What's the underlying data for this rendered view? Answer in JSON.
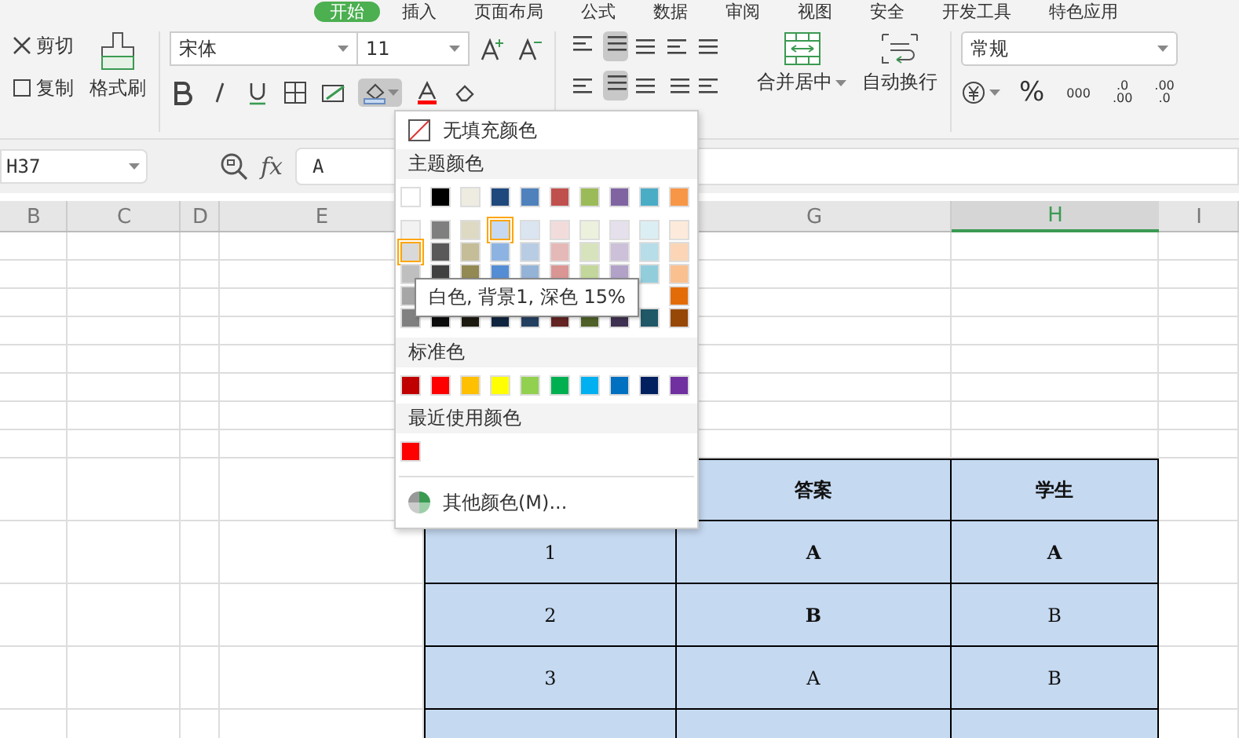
{
  "tabs": [
    {
      "label": "开始",
      "selected": true
    },
    {
      "label": "插入",
      "selected": false
    },
    {
      "label": "页面布局",
      "selected": false
    },
    {
      "label": "公式",
      "selected": false
    },
    {
      "label": "数据",
      "selected": false
    },
    {
      "label": "审阅",
      "selected": false
    },
    {
      "label": "视图",
      "selected": false
    },
    {
      "label": "安全",
      "selected": false
    },
    {
      "label": "开发工具",
      "selected": false
    },
    {
      "label": "特色应用",
      "selected": false
    }
  ],
  "clipboard": {
    "cut": "剪切",
    "copy": "复制",
    "format_painter": "格式刷"
  },
  "font": {
    "name": "宋体",
    "size": "11"
  },
  "alignment": {
    "merge": "合并居中",
    "wrap": "自动换行"
  },
  "number": {
    "format": "常规",
    "percent": "%",
    "thousands": "000",
    "decimals": [
      {
        "top": ".0",
        "bottom": ".00"
      },
      {
        "top": ".00",
        "bottom": ".0"
      }
    ]
  },
  "formula_bar": {
    "name_box": "H37",
    "function_label": "fx",
    "formula": "A"
  },
  "columns": [
    {
      "label": "B",
      "selected": false
    },
    {
      "label": "C",
      "selected": false
    },
    {
      "label": "D",
      "selected": false
    },
    {
      "label": "E",
      "selected": false
    },
    {
      "label": "G",
      "selected": false
    },
    {
      "label": "H",
      "selected": true
    },
    {
      "label": "I",
      "selected": false
    }
  ],
  "table": {
    "header": [
      "答案",
      "学生"
    ],
    "rows": [
      [
        {
          "text": "1",
          "bold": false
        },
        {
          "text": "A",
          "bold": true
        },
        {
          "text": "A",
          "bold": true
        }
      ],
      [
        {
          "text": "2",
          "bold": false
        },
        {
          "text": "B",
          "bold": true
        },
        {
          "text": "B",
          "bold": false
        }
      ],
      [
        {
          "text": "3",
          "bold": false
        },
        {
          "text": "A",
          "bold": false
        },
        {
          "text": "B",
          "bold": false
        }
      ]
    ]
  },
  "fill_menu": {
    "no_fill": "无填充颜色",
    "theme_title": "主题颜色",
    "standard_title": "标准色",
    "recent_title": "最近使用颜色",
    "more": "其他颜色(M)...",
    "tooltip": "白色, 背景1, 深色 15%",
    "theme_rows": [
      [
        {
          "color": "#ffffff",
          "selected": false
        },
        {
          "color": "#000000",
          "selected": false
        },
        {
          "color": "#eeece1",
          "selected": false
        },
        {
          "color": "#1f497d",
          "selected": false
        },
        {
          "color": "#4f81bd",
          "selected": false
        },
        {
          "color": "#c0504d",
          "selected": false
        },
        {
          "color": "#9bbb59",
          "selected": false
        },
        {
          "color": "#8064a2",
          "selected": false
        },
        {
          "color": "#4bacc6",
          "selected": false
        },
        {
          "color": "#f79646",
          "selected": false
        }
      ],
      [
        {
          "color": "#f2f2f2",
          "selected": false
        },
        {
          "color": "#7f7f7f",
          "selected": false
        },
        {
          "color": "#ddd9c3",
          "selected": false
        },
        {
          "color": "#c6d9f0",
          "selected": true
        },
        {
          "color": "#dbe5f1",
          "selected": false
        },
        {
          "color": "#f2dcdb",
          "selected": false
        },
        {
          "color": "#ebf1dd",
          "selected": false
        },
        {
          "color": "#e5e0ec",
          "selected": false
        },
        {
          "color": "#dbeef3",
          "selected": false
        },
        {
          "color": "#fdeada",
          "selected": false
        }
      ],
      [
        {
          "color": "#d9d9d9",
          "selected": true
        },
        {
          "color": "#595959",
          "selected": false
        },
        {
          "color": "#c4bd97",
          "selected": false
        },
        {
          "color": "#8db3e2",
          "selected": false
        },
        {
          "color": "#b8cce4",
          "selected": false
        },
        {
          "color": "#e5b9b7",
          "selected": false
        },
        {
          "color": "#d7e3bc",
          "selected": false
        },
        {
          "color": "#ccc1d9",
          "selected": false
        },
        {
          "color": "#b7dde8",
          "selected": false
        },
        {
          "color": "#fbd5b5",
          "selected": false
        }
      ],
      [
        {
          "color": "#bfbfbf",
          "selected": false
        },
        {
          "color": "#404040",
          "selected": false
        },
        {
          "color": "#938953",
          "selected": false
        },
        {
          "color": "#548dd4",
          "selected": false
        },
        {
          "color": "#95b3d7",
          "selected": false
        },
        {
          "color": "#d99694",
          "selected": false
        },
        {
          "color": "#c3d69b",
          "selected": false
        },
        {
          "color": "#b2a2c7",
          "selected": false
        },
        {
          "color": "#92cddc",
          "selected": false
        },
        {
          "color": "#fac08f",
          "selected": false
        }
      ],
      [
        {
          "color": "#a6a6a6",
          "selected": false
        },
        {
          "color": "#e36c09",
          "selected": false
        }
      ],
      [
        {
          "color": "#808080",
          "selected": false
        },
        {
          "color": "#0d0d0d",
          "selected": false
        },
        {
          "color": "#1d1b10",
          "selected": false
        },
        {
          "color": "#0f243e",
          "selected": false
        },
        {
          "color": "#244061",
          "selected": false
        },
        {
          "color": "#632423",
          "selected": false
        },
        {
          "color": "#4f6128",
          "selected": false
        },
        {
          "color": "#3f3151",
          "selected": false
        },
        {
          "color": "#205867",
          "selected": false
        },
        {
          "color": "#974806",
          "selected": false
        }
      ]
    ],
    "standard": [
      {
        "color": "#c00000"
      },
      {
        "color": "#ff0000"
      },
      {
        "color": "#ffc000"
      },
      {
        "color": "#ffff00"
      },
      {
        "color": "#92d050"
      },
      {
        "color": "#00b050"
      },
      {
        "color": "#00b0f0"
      },
      {
        "color": "#0070c0"
      },
      {
        "color": "#002060"
      },
      {
        "color": "#7030a0"
      }
    ],
    "recent": [
      {
        "color": "#ff0000"
      }
    ]
  }
}
